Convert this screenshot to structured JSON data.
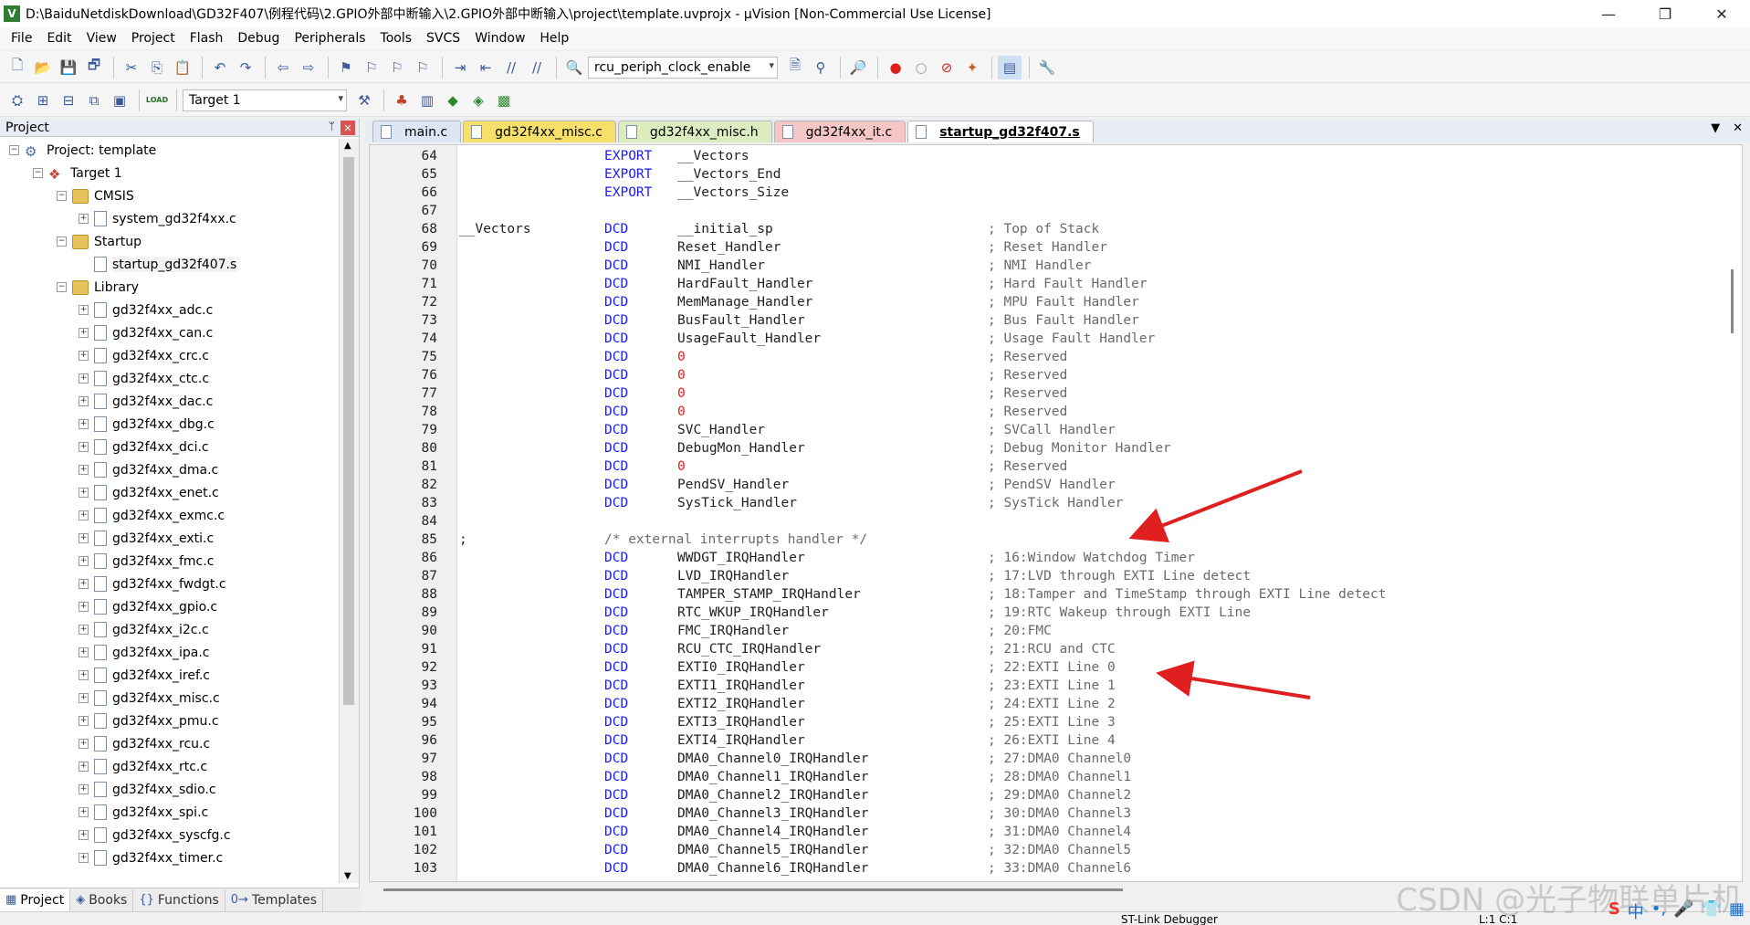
{
  "window": {
    "title": "D:\\BaiduNetdiskDownload\\GD32F407\\例程代码\\2.GPIO外部中断输入\\2.GPIO外部中断输入\\project\\template.uvprojx - µVision  [Non-Commercial Use License]",
    "app_icon": "V",
    "minimize": "—",
    "maximize": "❐",
    "close": "✕"
  },
  "menu": [
    "File",
    "Edit",
    "View",
    "Project",
    "Flash",
    "Debug",
    "Peripherals",
    "Tools",
    "SVCS",
    "Window",
    "Help"
  ],
  "toolbar": {
    "find_combo": "rcu_periph_clock_enable",
    "target_select": "Target 1",
    "load_label": "LOAD"
  },
  "project_pane": {
    "title": "Project",
    "pin": "ᛘ",
    "close": "✕",
    "tree": [
      {
        "label": "Project: template",
        "level": 0,
        "expander": "−",
        "icon": "project-icon"
      },
      {
        "label": "Target 1",
        "level": 1,
        "expander": "−",
        "icon": "target-icon"
      },
      {
        "label": "CMSIS",
        "level": 2,
        "expander": "−",
        "icon": "folder-icon"
      },
      {
        "label": "system_gd32f4xx.c",
        "level": 3,
        "expander": "+",
        "icon": "file-icon"
      },
      {
        "label": "Startup",
        "level": 2,
        "expander": "−",
        "icon": "folder-icon"
      },
      {
        "label": "startup_gd32f407.s",
        "level": 3,
        "expander": "",
        "icon": "file-icon",
        "selected": true
      },
      {
        "label": "Library",
        "level": 2,
        "expander": "−",
        "icon": "folder-icon"
      },
      {
        "label": "gd32f4xx_adc.c",
        "level": 3,
        "expander": "+",
        "icon": "file-icon"
      },
      {
        "label": "gd32f4xx_can.c",
        "level": 3,
        "expander": "+",
        "icon": "file-icon"
      },
      {
        "label": "gd32f4xx_crc.c",
        "level": 3,
        "expander": "+",
        "icon": "file-icon"
      },
      {
        "label": "gd32f4xx_ctc.c",
        "level": 3,
        "expander": "+",
        "icon": "file-icon"
      },
      {
        "label": "gd32f4xx_dac.c",
        "level": 3,
        "expander": "+",
        "icon": "file-icon"
      },
      {
        "label": "gd32f4xx_dbg.c",
        "level": 3,
        "expander": "+",
        "icon": "file-icon"
      },
      {
        "label": "gd32f4xx_dci.c",
        "level": 3,
        "expander": "+",
        "icon": "file-icon"
      },
      {
        "label": "gd32f4xx_dma.c",
        "level": 3,
        "expander": "+",
        "icon": "file-icon"
      },
      {
        "label": "gd32f4xx_enet.c",
        "level": 3,
        "expander": "+",
        "icon": "file-icon"
      },
      {
        "label": "gd32f4xx_exmc.c",
        "level": 3,
        "expander": "+",
        "icon": "file-icon"
      },
      {
        "label": "gd32f4xx_exti.c",
        "level": 3,
        "expander": "+",
        "icon": "file-icon"
      },
      {
        "label": "gd32f4xx_fmc.c",
        "level": 3,
        "expander": "+",
        "icon": "file-icon"
      },
      {
        "label": "gd32f4xx_fwdgt.c",
        "level": 3,
        "expander": "+",
        "icon": "file-icon"
      },
      {
        "label": "gd32f4xx_gpio.c",
        "level": 3,
        "expander": "+",
        "icon": "file-icon"
      },
      {
        "label": "gd32f4xx_i2c.c",
        "level": 3,
        "expander": "+",
        "icon": "file-icon"
      },
      {
        "label": "gd32f4xx_ipa.c",
        "level": 3,
        "expander": "+",
        "icon": "file-icon"
      },
      {
        "label": "gd32f4xx_iref.c",
        "level": 3,
        "expander": "+",
        "icon": "file-icon"
      },
      {
        "label": "gd32f4xx_misc.c",
        "level": 3,
        "expander": "+",
        "icon": "file-icon"
      },
      {
        "label": "gd32f4xx_pmu.c",
        "level": 3,
        "expander": "+",
        "icon": "file-icon"
      },
      {
        "label": "gd32f4xx_rcu.c",
        "level": 3,
        "expander": "+",
        "icon": "file-icon"
      },
      {
        "label": "gd32f4xx_rtc.c",
        "level": 3,
        "expander": "+",
        "icon": "file-icon"
      },
      {
        "label": "gd32f4xx_sdio.c",
        "level": 3,
        "expander": "+",
        "icon": "file-icon"
      },
      {
        "label": "gd32f4xx_spi.c",
        "level": 3,
        "expander": "+",
        "icon": "file-icon"
      },
      {
        "label": "gd32f4xx_syscfg.c",
        "level": 3,
        "expander": "+",
        "icon": "file-icon"
      },
      {
        "label": "gd32f4xx_timer.c",
        "level": 3,
        "expander": "+",
        "icon": "file-icon"
      }
    ],
    "bottom_tabs": [
      {
        "label": "Project",
        "icon": "▦"
      },
      {
        "label": "Books",
        "icon": "◈"
      },
      {
        "label": "Functions",
        "icon": "{}"
      },
      {
        "label": "Templates",
        "icon": "0→"
      }
    ]
  },
  "editor_tabs": [
    {
      "label": "main.c",
      "cls": "main"
    },
    {
      "label": "gd32f4xx_misc.c",
      "cls": "misc-c"
    },
    {
      "label": "gd32f4xx_misc.h",
      "cls": "misc-h"
    },
    {
      "label": "gd32f4xx_it.c",
      "cls": "it-c"
    },
    {
      "label": "startup_gd32f407.s",
      "cls": "startup"
    }
  ],
  "editor_tab_controls": {
    "dropdown": "▼",
    "close": "✕"
  },
  "code_lines": [
    {
      "n": "64",
      "lbl": "",
      "kw": "EXPORT",
      "arg": "__Vectors",
      "cmt": ""
    },
    {
      "n": "65",
      "lbl": "",
      "kw": "EXPORT",
      "arg": "__Vectors_End",
      "cmt": ""
    },
    {
      "n": "66",
      "lbl": "",
      "kw": "EXPORT",
      "arg": "__Vectors_Size",
      "cmt": ""
    },
    {
      "n": "67",
      "lbl": "",
      "kw": "",
      "arg": "",
      "cmt": ""
    },
    {
      "n": "68",
      "lbl": "__Vectors",
      "kw": "DCD",
      "arg": "__initial_sp",
      "cmt": "; Top of Stack"
    },
    {
      "n": "69",
      "lbl": "",
      "kw": "DCD",
      "arg": "Reset_Handler",
      "cmt": "; Reset Handler"
    },
    {
      "n": "70",
      "lbl": "",
      "kw": "DCD",
      "arg": "NMI_Handler",
      "cmt": "; NMI Handler"
    },
    {
      "n": "71",
      "lbl": "",
      "kw": "DCD",
      "arg": "HardFault_Handler",
      "cmt": "; Hard Fault Handler"
    },
    {
      "n": "72",
      "lbl": "",
      "kw": "DCD",
      "arg": "MemManage_Handler",
      "cmt": "; MPU Fault Handler"
    },
    {
      "n": "73",
      "lbl": "",
      "kw": "DCD",
      "arg": "BusFault_Handler",
      "cmt": "; Bus Fault Handler"
    },
    {
      "n": "74",
      "lbl": "",
      "kw": "DCD",
      "arg": "UsageFault_Handler",
      "cmt": "; Usage Fault Handler"
    },
    {
      "n": "75",
      "lbl": "",
      "kw": "DCD",
      "arg": "0",
      "num": true,
      "cmt": "; Reserved"
    },
    {
      "n": "76",
      "lbl": "",
      "kw": "DCD",
      "arg": "0",
      "num": true,
      "cmt": "; Reserved"
    },
    {
      "n": "77",
      "lbl": "",
      "kw": "DCD",
      "arg": "0",
      "num": true,
      "cmt": "; Reserved"
    },
    {
      "n": "78",
      "lbl": "",
      "kw": "DCD",
      "arg": "0",
      "num": true,
      "cmt": "; Reserved"
    },
    {
      "n": "79",
      "lbl": "",
      "kw": "DCD",
      "arg": "SVC_Handler",
      "cmt": "; SVCall Handler"
    },
    {
      "n": "80",
      "lbl": "",
      "kw": "DCD",
      "arg": "DebugMon_Handler",
      "cmt": "; Debug Monitor Handler"
    },
    {
      "n": "81",
      "lbl": "",
      "kw": "DCD",
      "arg": "0",
      "num": true,
      "cmt": "; Reserved"
    },
    {
      "n": "82",
      "lbl": "",
      "kw": "DCD",
      "arg": "PendSV_Handler",
      "cmt": "; PendSV Handler"
    },
    {
      "n": "83",
      "lbl": "",
      "kw": "DCD",
      "arg": "SysTick_Handler",
      "cmt": "; SysTick Handler"
    },
    {
      "n": "84",
      "lbl": "",
      "kw": "",
      "arg": "",
      "cmt": ""
    },
    {
      "n": "85",
      "lbl": ";",
      "kw": "",
      "arg": "",
      "cmt": "",
      "inline_cmt": "/* external interrupts handler */"
    },
    {
      "n": "86",
      "lbl": "",
      "kw": "DCD",
      "arg": "WWDGT_IRQHandler",
      "cmt": "; 16:Window Watchdog Timer"
    },
    {
      "n": "87",
      "lbl": "",
      "kw": "DCD",
      "arg": "LVD_IRQHandler",
      "cmt": "; 17:LVD through EXTI Line detect"
    },
    {
      "n": "88",
      "lbl": "",
      "kw": "DCD",
      "arg": "TAMPER_STAMP_IRQHandler",
      "cmt": "; 18:Tamper and TimeStamp through EXTI Line detect"
    },
    {
      "n": "89",
      "lbl": "",
      "kw": "DCD",
      "arg": "RTC_WKUP_IRQHandler",
      "cmt": "; 19:RTC Wakeup through EXTI Line"
    },
    {
      "n": "90",
      "lbl": "",
      "kw": "DCD",
      "arg": "FMC_IRQHandler",
      "cmt": "; 20:FMC"
    },
    {
      "n": "91",
      "lbl": "",
      "kw": "DCD",
      "arg": "RCU_CTC_IRQHandler",
      "cmt": "; 21:RCU and CTC"
    },
    {
      "n": "92",
      "lbl": "",
      "kw": "DCD",
      "arg": "EXTI0_IRQHandler",
      "cmt": "; 22:EXTI Line 0"
    },
    {
      "n": "93",
      "lbl": "",
      "kw": "DCD",
      "arg": "EXTI1_IRQHandler",
      "cmt": "; 23:EXTI Line 1"
    },
    {
      "n": "94",
      "lbl": "",
      "kw": "DCD",
      "arg": "EXTI2_IRQHandler",
      "cmt": "; 24:EXTI Line 2"
    },
    {
      "n": "95",
      "lbl": "",
      "kw": "DCD",
      "arg": "EXTI3_IRQHandler",
      "cmt": "; 25:EXTI Line 3"
    },
    {
      "n": "96",
      "lbl": "",
      "kw": "DCD",
      "arg": "EXTI4_IRQHandler",
      "cmt": "; 26:EXTI Line 4"
    },
    {
      "n": "97",
      "lbl": "",
      "kw": "DCD",
      "arg": "DMA0_Channel0_IRQHandler",
      "cmt": "; 27:DMA0 Channel0"
    },
    {
      "n": "98",
      "lbl": "",
      "kw": "DCD",
      "arg": "DMA0_Channel1_IRQHandler",
      "cmt": "; 28:DMA0 Channel1"
    },
    {
      "n": "99",
      "lbl": "",
      "kw": "DCD",
      "arg": "DMA0_Channel2_IRQHandler",
      "cmt": "; 29:DMA0 Channel2"
    },
    {
      "n": "100",
      "lbl": "",
      "kw": "DCD",
      "arg": "DMA0_Channel3_IRQHandler",
      "cmt": "; 30:DMA0 Channel3"
    },
    {
      "n": "101",
      "lbl": "",
      "kw": "DCD",
      "arg": "DMA0_Channel4_IRQHandler",
      "cmt": "; 31:DMA0 Channel4"
    },
    {
      "n": "102",
      "lbl": "",
      "kw": "DCD",
      "arg": "DMA0_Channel5_IRQHandler",
      "cmt": "; 32:DMA0 Channel5"
    },
    {
      "n": "103",
      "lbl": "",
      "kw": "DCD",
      "arg": "DMA0_Channel6_IRQHandler",
      "cmt": "; 33:DMA0 Channel6"
    }
  ],
  "status": {
    "debugger": "ST-Link Debugger",
    "position": "L:1 C:1"
  },
  "watermark": "CSDN @光子物联单片机",
  "ime": {
    "logo": "S",
    "lang": "中",
    "punct": "•,",
    "mic": "🎤",
    "skin": "👕",
    "grid": "▦"
  },
  "colors": {
    "keyword": "#1a1aff",
    "number": "#e02020",
    "comment": "#6a6a6a",
    "annotation_arrow": "#e02020"
  }
}
